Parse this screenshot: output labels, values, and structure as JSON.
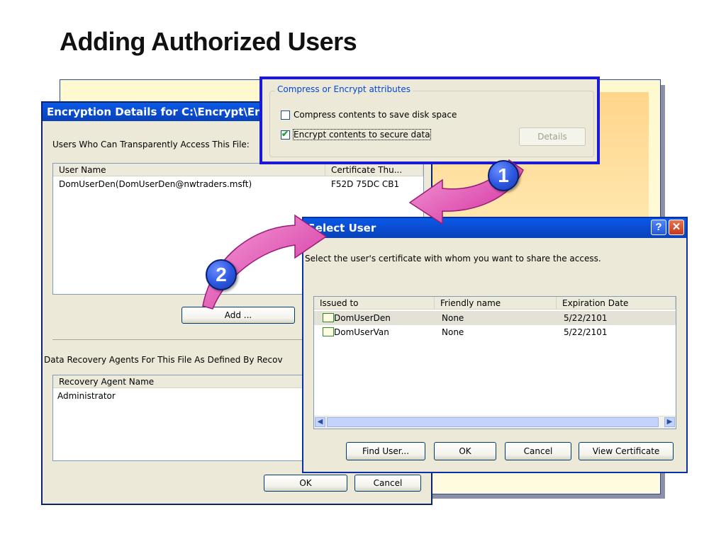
{
  "slide": {
    "title": "Adding Authorized Users"
  },
  "encryption_dialog": {
    "title": "Encryption Details for C:\\Encrypt\\Encr",
    "users_label": "Users Who Can Transparently Access This File:",
    "columns": [
      "User Name",
      "Certificate Thu..."
    ],
    "rows": [
      {
        "user": "DomUserDen(DomUserDen@nwtraders.msft)",
        "thumb": "F52D 75DC CB1"
      }
    ],
    "add_label": "Add ...",
    "recovery_label": "Data Recovery Agents For This File As Defined By Recov",
    "recovery_column": "Recovery Agent Name",
    "recovery_rows": [
      "Administrator"
    ],
    "ok_label": "OK",
    "cancel_label": "Cancel"
  },
  "attributes_panel": {
    "group_title": "Compress or Encrypt attributes",
    "compress_label": "Compress contents to save disk space",
    "compress_checked": false,
    "encrypt_label": "Encrypt contents to secure data",
    "encrypt_checked": true,
    "details_label": "Details"
  },
  "select_user_dialog": {
    "title": "Select User",
    "instruction": "Select the user's certificate with whom you want to share the access.",
    "columns": [
      "Issued to",
      "Friendly name",
      "Expiration Date"
    ],
    "rows": [
      {
        "issued_to": "DomUserDen",
        "friendly": "None",
        "expires": "5/22/2101"
      },
      {
        "issued_to": "DomUserVan",
        "friendly": "None",
        "expires": "5/22/2101"
      }
    ],
    "find_user_label": "Find User...",
    "ok_label": "OK",
    "cancel_label": "Cancel",
    "view_cert_label": "View Certificate",
    "help_label": "?"
  },
  "callouts": {
    "one": "1",
    "two": "2"
  },
  "colors": {
    "titlebar": "#0a4ed6",
    "callout": "#2a56e0",
    "arrow": "#e23fae",
    "panel": "#fff9cf"
  }
}
